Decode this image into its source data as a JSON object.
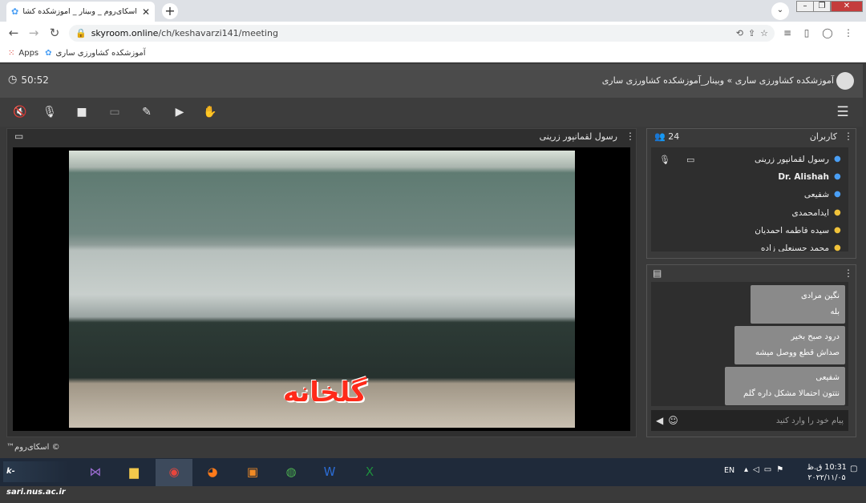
{
  "browser": {
    "tab_title": "اسکای‌روم _ وبینار _ آموزشکده کشاورزی ...",
    "url_host": "skyroom.online",
    "url_path": "/ch/keshavarzi141/meeting",
    "bookmarks": [
      {
        "label": "Apps",
        "icon": "apps-grid-icon"
      },
      {
        "label": "آموزشکده کشاورزی ساری",
        "icon": "skyroom-logo-icon"
      }
    ]
  },
  "meeting": {
    "timer": "50:52",
    "title": "آموزشکده کشاورزی ساری » وبینار_آموزشکده کشاورزی ساری",
    "toolbar_icons": [
      "speaker-muted-icon",
      "mic-muted-icon",
      "camera-icon",
      "screen-share-icon",
      "brush-icon",
      "play-media-icon",
      "raise-hand-icon"
    ]
  },
  "video": {
    "presenter": "رسول لقمانپور زرینی",
    "caption": "گلخانه"
  },
  "users": {
    "title": "کاربران",
    "count": "24",
    "list": [
      {
        "name": "رسول لقمانپور زرینی",
        "role_color": "#4a9ff5"
      },
      {
        "name": "Dr. Alishah",
        "role_color": "#4a9ff5"
      },
      {
        "name": "شفیعی",
        "role_color": "#4a9ff5"
      },
      {
        "name": "ایدامحمدی",
        "role_color": "#f0c23a"
      },
      {
        "name": "سیده فاطمه احمدیان",
        "role_color": "#f0c23a"
      },
      {
        "name": "محمد حسنعلی زاده",
        "role_color": "#f0c23a"
      }
    ]
  },
  "chat": {
    "messages": [
      {
        "author": "نگین مرادی",
        "text": "بله"
      },
      {
        "author": "درود صبح بخیر",
        "text": "صداش قطع ووصل میشه"
      },
      {
        "author": "شفیعی",
        "text": "نتتون احتمالا مشکل داره گلم"
      }
    ],
    "input_placeholder": "پیام خود را وارد کنید"
  },
  "footer": {
    "copyright": "© اسکای‌روم™"
  },
  "taskbar": {
    "start_label": "k-sari.nus.ac.ir",
    "language": "EN",
    "time": "10:31 ق.ظ",
    "date": "۲۰۲۲/۱۱/۰۵"
  },
  "colors": {
    "header_bg": "#4b4b4b",
    "panel_bg": "#3a3a3a",
    "accent_red": "#ff2a1a",
    "taskbar_bg": "#1f2a3a"
  }
}
